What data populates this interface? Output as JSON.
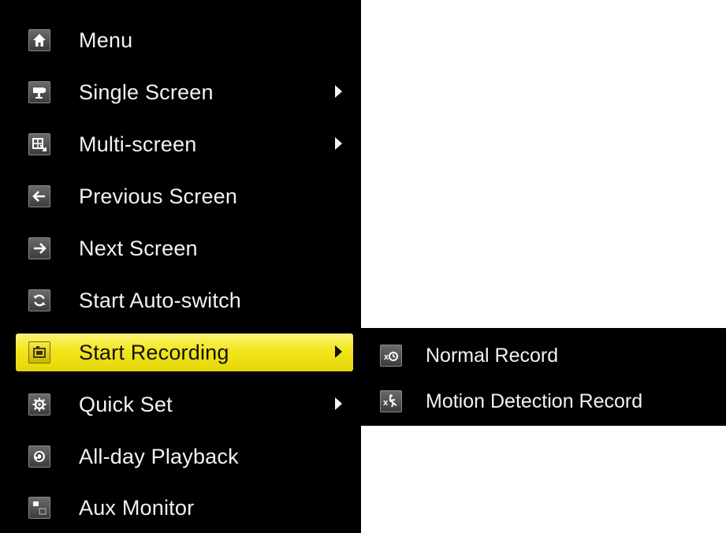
{
  "main_menu": {
    "items": [
      {
        "label": "Menu",
        "icon": "home-icon",
        "has_submenu": false
      },
      {
        "label": "Single Screen",
        "icon": "camera-icon",
        "has_submenu": true
      },
      {
        "label": "Multi-screen",
        "icon": "multi-screen-icon",
        "has_submenu": true
      },
      {
        "label": "Previous Screen",
        "icon": "arrow-left-icon",
        "has_submenu": false
      },
      {
        "label": "Next Screen",
        "icon": "arrow-right-icon",
        "has_submenu": false
      },
      {
        "label": "Start Auto-switch",
        "icon": "refresh-icon",
        "has_submenu": false
      },
      {
        "label": "Start Recording",
        "icon": "recording-icon",
        "has_submenu": true,
        "selected": true
      },
      {
        "label": "Quick Set",
        "icon": "gear-icon",
        "has_submenu": true
      },
      {
        "label": "All-day Playback",
        "icon": "playback-icon",
        "has_submenu": false
      },
      {
        "label": "Aux Monitor",
        "icon": "aux-monitor-icon",
        "has_submenu": false
      }
    ]
  },
  "sub_menu": {
    "items": [
      {
        "label": "Normal Record",
        "icon": "normal-record-icon"
      },
      {
        "label": "Motion Detection Record",
        "icon": "motion-detection-icon"
      }
    ]
  },
  "colors": {
    "menu_background": "#000000",
    "text": "#f2f2f2",
    "highlight": "#f2e61c",
    "highlight_text": "#111111"
  }
}
